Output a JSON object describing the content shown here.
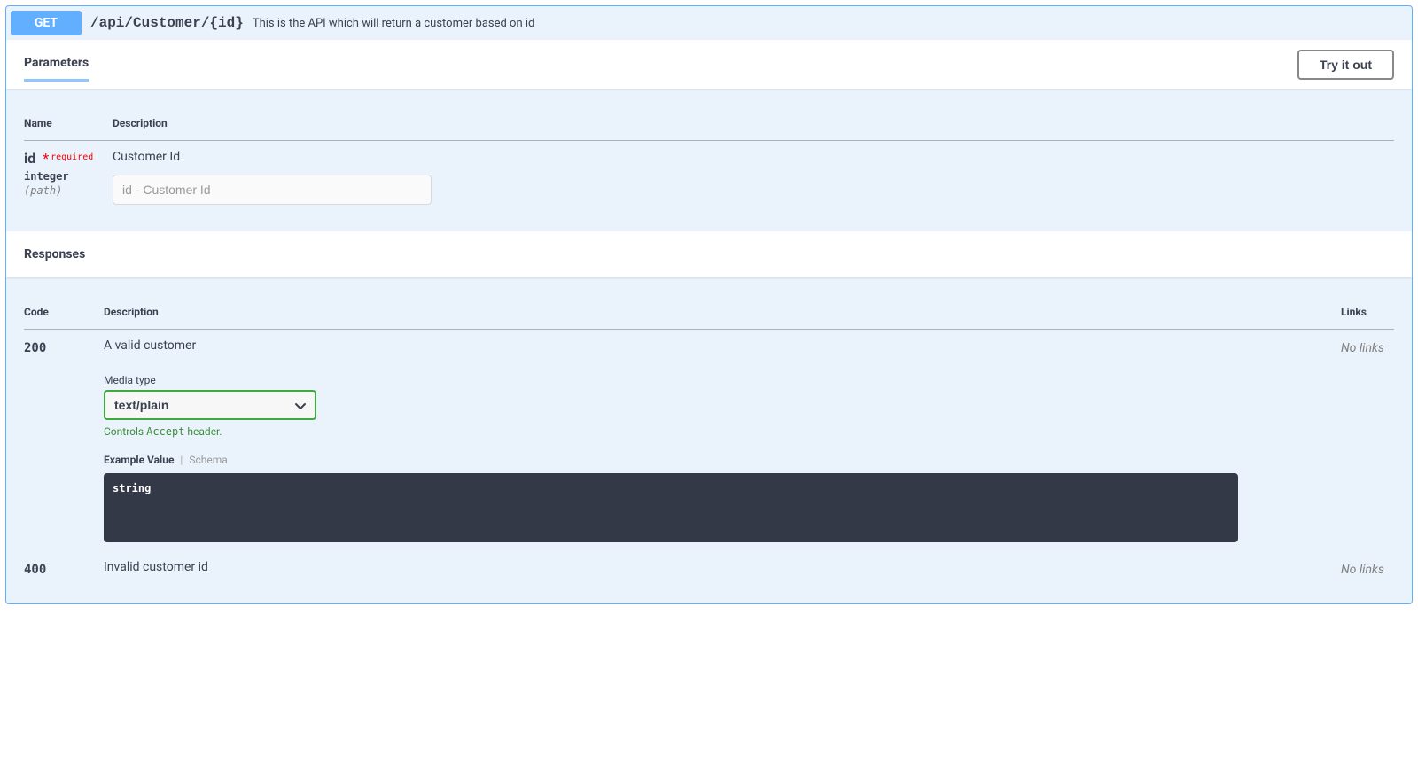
{
  "operation": {
    "method": "GET",
    "path": "/api/Customer/{id}",
    "summary": "This is the API which will return a customer based on id"
  },
  "sections": {
    "parameters_title": "Parameters",
    "responses_title": "Responses",
    "try_it_out": "Try it out"
  },
  "param_headers": {
    "name": "Name",
    "description": "Description"
  },
  "params": [
    {
      "name": "id",
      "required_label": "required",
      "type": "integer",
      "in": "(path)",
      "description": "Customer Id",
      "placeholder": "id - Customer Id"
    }
  ],
  "response_headers": {
    "code": "Code",
    "description": "Description",
    "links": "Links"
  },
  "media": {
    "label": "Media type",
    "selected": "text/plain",
    "note_prefix": "Controls ",
    "note_code": "Accept",
    "note_suffix": " header."
  },
  "example_tabs": {
    "active": "Example Value",
    "inactive": "Schema"
  },
  "responses": [
    {
      "code": "200",
      "description": "A valid customer",
      "links": "No links",
      "example": "string",
      "has_media": true
    },
    {
      "code": "400",
      "description": "Invalid customer id",
      "links": "No links",
      "has_media": false
    }
  ]
}
